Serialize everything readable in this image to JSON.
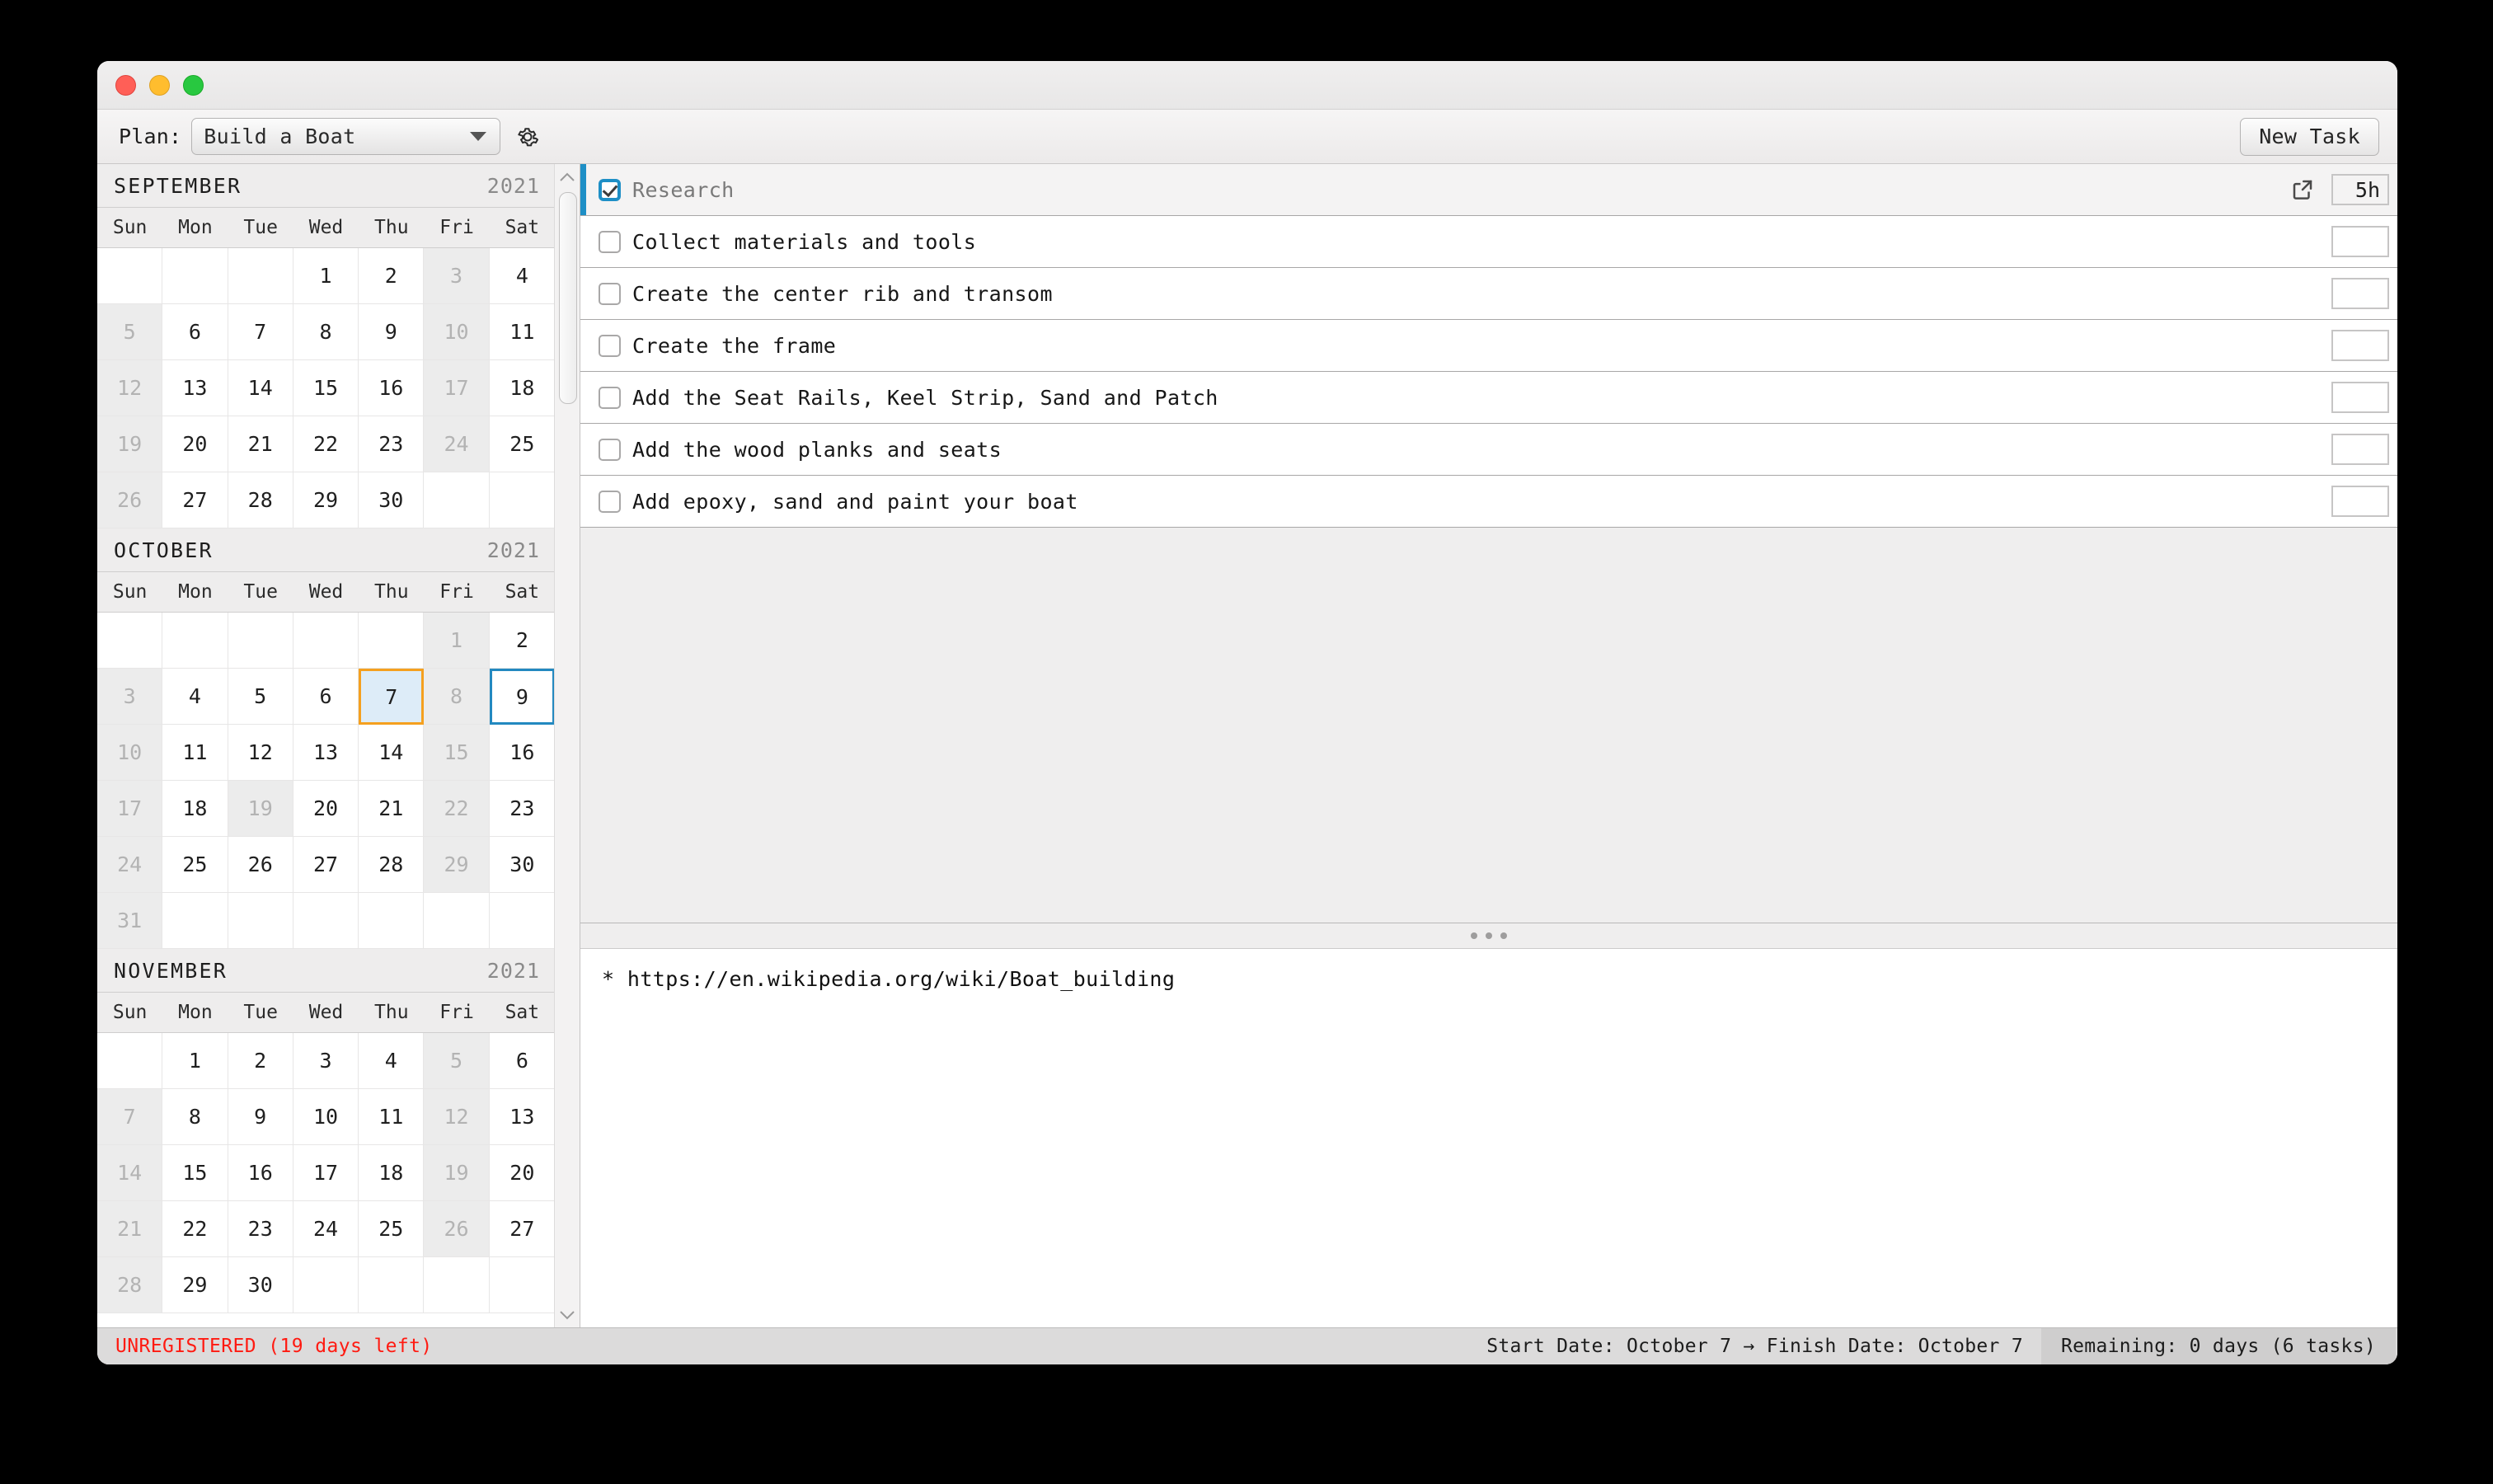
{
  "window": {
    "traffic_lights": [
      "close",
      "minimize",
      "maximize"
    ]
  },
  "toolbar": {
    "plan_label": "Plan:",
    "plan_value": "Build a Boat",
    "plan_options": [
      "Build a Boat"
    ],
    "settings_icon": "gear-icon",
    "dropdown_icon": "chevron-down-icon",
    "new_task_label": "New Task"
  },
  "calendar": {
    "day_names": [
      "Sun",
      "Mon",
      "Tue",
      "Wed",
      "Thu",
      "Fri",
      "Sat"
    ],
    "scroll_up_icon": "chevron-up-icon",
    "scroll_down_icon": "chevron-down-icon",
    "months": [
      {
        "name": "SEPTEMBER",
        "year": "2021",
        "weeks": [
          [
            {
              "d": "",
              "state": "empty"
            },
            {
              "d": "",
              "state": "empty"
            },
            {
              "d": "",
              "state": "empty"
            },
            {
              "d": "1",
              "state": "on"
            },
            {
              "d": "2",
              "state": "on"
            },
            {
              "d": "3",
              "state": "off"
            },
            {
              "d": "4",
              "state": "on"
            }
          ],
          [
            {
              "d": "5",
              "state": "off"
            },
            {
              "d": "6",
              "state": "on"
            },
            {
              "d": "7",
              "state": "on"
            },
            {
              "d": "8",
              "state": "on"
            },
            {
              "d": "9",
              "state": "on"
            },
            {
              "d": "10",
              "state": "off"
            },
            {
              "d": "11",
              "state": "on"
            }
          ],
          [
            {
              "d": "12",
              "state": "off"
            },
            {
              "d": "13",
              "state": "on"
            },
            {
              "d": "14",
              "state": "on"
            },
            {
              "d": "15",
              "state": "on"
            },
            {
              "d": "16",
              "state": "on"
            },
            {
              "d": "17",
              "state": "off"
            },
            {
              "d": "18",
              "state": "on"
            }
          ],
          [
            {
              "d": "19",
              "state": "off"
            },
            {
              "d": "20",
              "state": "on"
            },
            {
              "d": "21",
              "state": "on"
            },
            {
              "d": "22",
              "state": "on"
            },
            {
              "d": "23",
              "state": "on"
            },
            {
              "d": "24",
              "state": "off"
            },
            {
              "d": "25",
              "state": "on"
            }
          ],
          [
            {
              "d": "26",
              "state": "off"
            },
            {
              "d": "27",
              "state": "on"
            },
            {
              "d": "28",
              "state": "on"
            },
            {
              "d": "29",
              "state": "on"
            },
            {
              "d": "30",
              "state": "on"
            },
            {
              "d": "",
              "state": "empty"
            },
            {
              "d": "",
              "state": "empty"
            }
          ]
        ]
      },
      {
        "name": "OCTOBER",
        "year": "2021",
        "weeks": [
          [
            {
              "d": "",
              "state": "empty"
            },
            {
              "d": "",
              "state": "empty"
            },
            {
              "d": "",
              "state": "empty"
            },
            {
              "d": "",
              "state": "empty"
            },
            {
              "d": "",
              "state": "empty"
            },
            {
              "d": "1",
              "state": "off"
            },
            {
              "d": "2",
              "state": "on"
            }
          ],
          [
            {
              "d": "3",
              "state": "off"
            },
            {
              "d": "4",
              "state": "on"
            },
            {
              "d": "5",
              "state": "on"
            },
            {
              "d": "6",
              "state": "on"
            },
            {
              "d": "7",
              "state": "sel"
            },
            {
              "d": "8",
              "state": "off"
            },
            {
              "d": "9",
              "state": "finish"
            }
          ],
          [
            {
              "d": "10",
              "state": "off"
            },
            {
              "d": "11",
              "state": "on"
            },
            {
              "d": "12",
              "state": "on"
            },
            {
              "d": "13",
              "state": "on"
            },
            {
              "d": "14",
              "state": "on"
            },
            {
              "d": "15",
              "state": "off"
            },
            {
              "d": "16",
              "state": "on"
            }
          ],
          [
            {
              "d": "17",
              "state": "off"
            },
            {
              "d": "18",
              "state": "on"
            },
            {
              "d": "19",
              "state": "off"
            },
            {
              "d": "20",
              "state": "on"
            },
            {
              "d": "21",
              "state": "on"
            },
            {
              "d": "22",
              "state": "off"
            },
            {
              "d": "23",
              "state": "on"
            }
          ],
          [
            {
              "d": "24",
              "state": "off"
            },
            {
              "d": "25",
              "state": "on"
            },
            {
              "d": "26",
              "state": "on"
            },
            {
              "d": "27",
              "state": "on"
            },
            {
              "d": "28",
              "state": "on"
            },
            {
              "d": "29",
              "state": "off"
            },
            {
              "d": "30",
              "state": "on"
            }
          ],
          [
            {
              "d": "31",
              "state": "off"
            },
            {
              "d": "",
              "state": "empty"
            },
            {
              "d": "",
              "state": "empty"
            },
            {
              "d": "",
              "state": "empty"
            },
            {
              "d": "",
              "state": "empty"
            },
            {
              "d": "",
              "state": "empty"
            },
            {
              "d": "",
              "state": "empty"
            }
          ]
        ]
      },
      {
        "name": "NOVEMBER",
        "year": "2021",
        "weeks": [
          [
            {
              "d": "",
              "state": "empty"
            },
            {
              "d": "1",
              "state": "on"
            },
            {
              "d": "2",
              "state": "on"
            },
            {
              "d": "3",
              "state": "on"
            },
            {
              "d": "4",
              "state": "on"
            },
            {
              "d": "5",
              "state": "off"
            },
            {
              "d": "6",
              "state": "on"
            }
          ],
          [
            {
              "d": "7",
              "state": "off"
            },
            {
              "d": "8",
              "state": "on"
            },
            {
              "d": "9",
              "state": "on"
            },
            {
              "d": "10",
              "state": "on"
            },
            {
              "d": "11",
              "state": "on"
            },
            {
              "d": "12",
              "state": "off"
            },
            {
              "d": "13",
              "state": "on"
            }
          ],
          [
            {
              "d": "14",
              "state": "off"
            },
            {
              "d": "15",
              "state": "on"
            },
            {
              "d": "16",
              "state": "on"
            },
            {
              "d": "17",
              "state": "on"
            },
            {
              "d": "18",
              "state": "on"
            },
            {
              "d": "19",
              "state": "off"
            },
            {
              "d": "20",
              "state": "on"
            }
          ],
          [
            {
              "d": "21",
              "state": "off"
            },
            {
              "d": "22",
              "state": "on"
            },
            {
              "d": "23",
              "state": "on"
            },
            {
              "d": "24",
              "state": "on"
            },
            {
              "d": "25",
              "state": "on"
            },
            {
              "d": "26",
              "state": "off"
            },
            {
              "d": "27",
              "state": "on"
            }
          ],
          [
            {
              "d": "28",
              "state": "off"
            },
            {
              "d": "29",
              "state": "on"
            },
            {
              "d": "30",
              "state": "on"
            },
            {
              "d": "",
              "state": "empty"
            },
            {
              "d": "",
              "state": "empty"
            },
            {
              "d": "",
              "state": "empty"
            },
            {
              "d": "",
              "state": "empty"
            }
          ]
        ]
      }
    ]
  },
  "tasks": {
    "header": {
      "label": "Research",
      "checked": true,
      "duration": "5h",
      "open_icon": "external-link-icon"
    },
    "rows": [
      {
        "label": "Collect materials and tools",
        "checked": false,
        "duration": ""
      },
      {
        "label": "Create the center rib and transom",
        "checked": false,
        "duration": ""
      },
      {
        "label": "Create the frame",
        "checked": false,
        "duration": ""
      },
      {
        "label": "Add the Seat Rails, Keel Strip, Sand and Patch",
        "checked": false,
        "duration": ""
      },
      {
        "label": "Add the wood planks and seats",
        "checked": false,
        "duration": ""
      },
      {
        "label": "Add epoxy, sand and paint your boat",
        "checked": false,
        "duration": ""
      }
    ]
  },
  "splitter": {
    "grip_icon": "drag-handle-icon"
  },
  "notes": {
    "text": "* https://en.wikipedia.org/wiki/Boat_building"
  },
  "statusbar": {
    "unregistered": "UNREGISTERED (19 days left)",
    "dates": "Start Date: October 7 → Finish Date: October 7",
    "remaining": "Remaining: 0 days (6 tasks)"
  },
  "colors": {
    "accent_blue": "#1e8fc6",
    "selected_orange": "#f5a01f",
    "finish_blue": "#2389c0",
    "warning_red": "#ff1a11"
  }
}
